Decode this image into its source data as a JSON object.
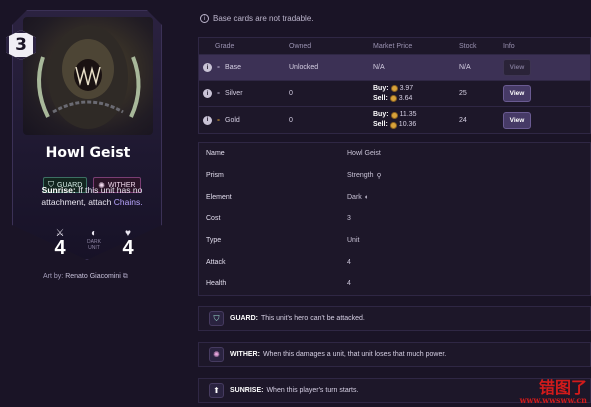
{
  "card": {
    "cost": "3",
    "name": "Howl Geist",
    "tags": [
      {
        "label": "GUARD",
        "icon": "shield-icon"
      },
      {
        "label": "WITHER",
        "icon": "wither-icon"
      }
    ],
    "text_keyword": "Sunrise:",
    "text_body": "If this unit has no attachment, attach",
    "text_link": "Chains.",
    "attack": "4",
    "health": "4",
    "prism_label_1": "DARK",
    "prism_label_2": "UNIT",
    "art_by_label": "Art by:",
    "artist": "Renato Giacomini"
  },
  "notice": "Base cards are not tradable.",
  "grades": {
    "headers": {
      "grade": "Grade",
      "owned": "Owned",
      "price": "Market Price",
      "stock": "Stock",
      "info": "Info"
    },
    "rows": [
      {
        "grade": "Base",
        "owned": "Unlocked",
        "price": "N/A",
        "stock": "N/A",
        "view": "View"
      },
      {
        "grade": "Silver",
        "owned": "0",
        "buy_label": "Buy:",
        "buy": "3.97",
        "sell_label": "Sell:",
        "sell": "3.64",
        "stock": "25",
        "view": "View"
      },
      {
        "grade": "Gold",
        "owned": "0",
        "buy_label": "Buy:",
        "buy": "11.35",
        "sell_label": "Sell:",
        "sell": "10.36",
        "stock": "24",
        "view": "View"
      }
    ]
  },
  "details": [
    {
      "label": "Name",
      "value": "Howl Geist"
    },
    {
      "label": "Prism",
      "value": "Strength"
    },
    {
      "label": "Element",
      "value": "Dark"
    },
    {
      "label": "Cost",
      "value": "3"
    },
    {
      "label": "Type",
      "value": "Unit"
    },
    {
      "label": "Attack",
      "value": "4"
    },
    {
      "label": "Health",
      "value": "4"
    }
  ],
  "keywords": [
    {
      "name": "GUARD:",
      "desc": "This unit's hero can't be attacked."
    },
    {
      "name": "WITHER:",
      "desc": "When this damages a unit, that unit loses that much power."
    },
    {
      "name": "SUNRISE:",
      "desc": "When this player's turn starts."
    }
  ],
  "watermark": {
    "line1": "错图了",
    "line2": "www.wwsww.cn"
  },
  "colors": {
    "accent": "#463a66",
    "selected_row": "#3c3155",
    "coin": "#d8a23a",
    "background": "#1a1426"
  }
}
